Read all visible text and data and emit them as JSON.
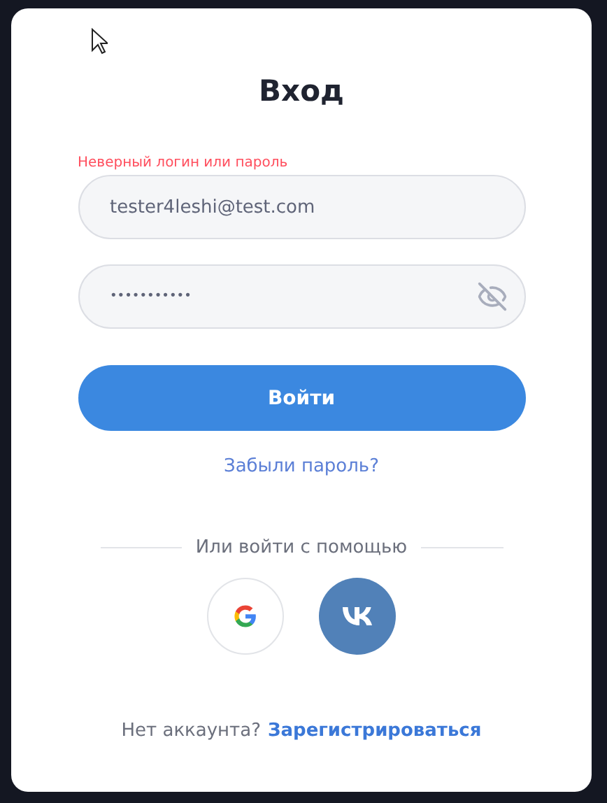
{
  "title": "Вход",
  "error": "Неверный логин или пароль",
  "login_field": {
    "value": "tester4leshi@test.com"
  },
  "password_field": {
    "value": "•••••••••••",
    "masked": true
  },
  "submit_button": "Войти",
  "forgot_link": "Забыли пароль?",
  "divider_text": "Или войти с помощью",
  "social": [
    {
      "kind": "google"
    },
    {
      "kind": "vk"
    }
  ],
  "footer": {
    "text": "Нет аккаунта?",
    "link": "Зарегистрироваться"
  }
}
